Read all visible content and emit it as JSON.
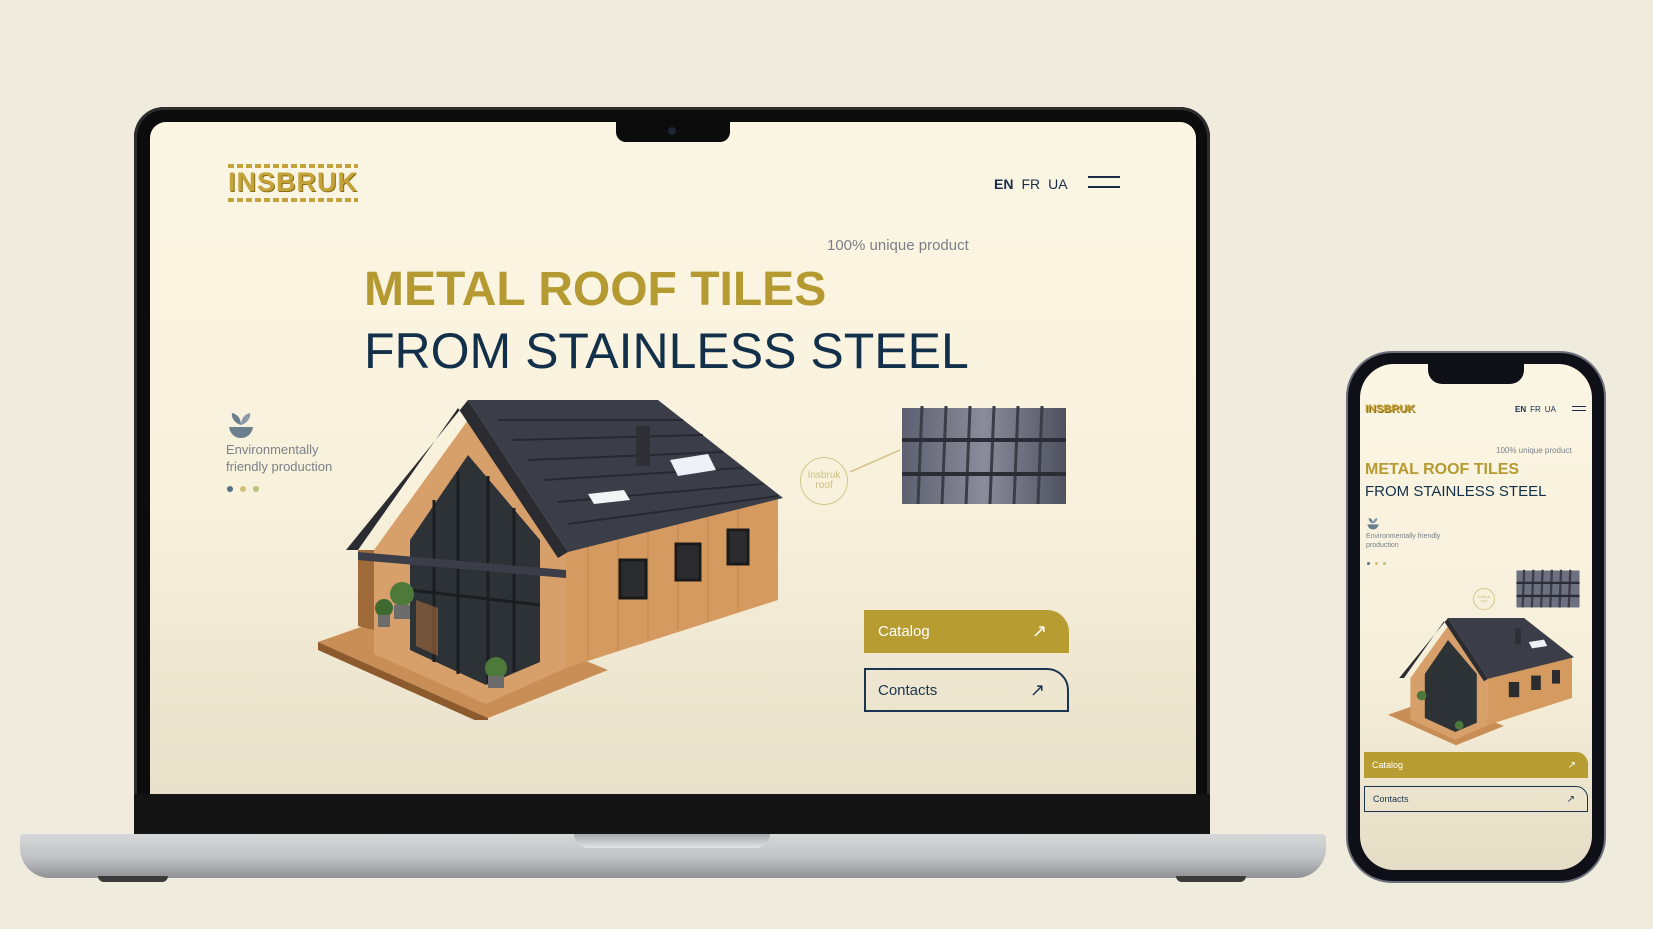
{
  "site": {
    "logo": "INSBRUK",
    "languages": [
      "EN",
      "FR",
      "UA"
    ],
    "tagline": "100% unique product",
    "headline_line1": "METAL ROOF TILES",
    "headline_line2": "FROM STAINLESS STEEL",
    "eco_line1": "Environmentally",
    "eco_line2": "friendly production",
    "eco_text_mobile_line1": "Environmentally friendly",
    "eco_text_mobile_line2": "production",
    "badge_line1": "Insbruk",
    "badge_line2": "roof",
    "catalog_label": "Catalog",
    "contacts_label": "Contacts",
    "arrow_icon": "↗",
    "slider_dots": 3,
    "colors": {
      "gold": "#b59a32",
      "navy": "#123049",
      "background": "#efebdd"
    }
  }
}
